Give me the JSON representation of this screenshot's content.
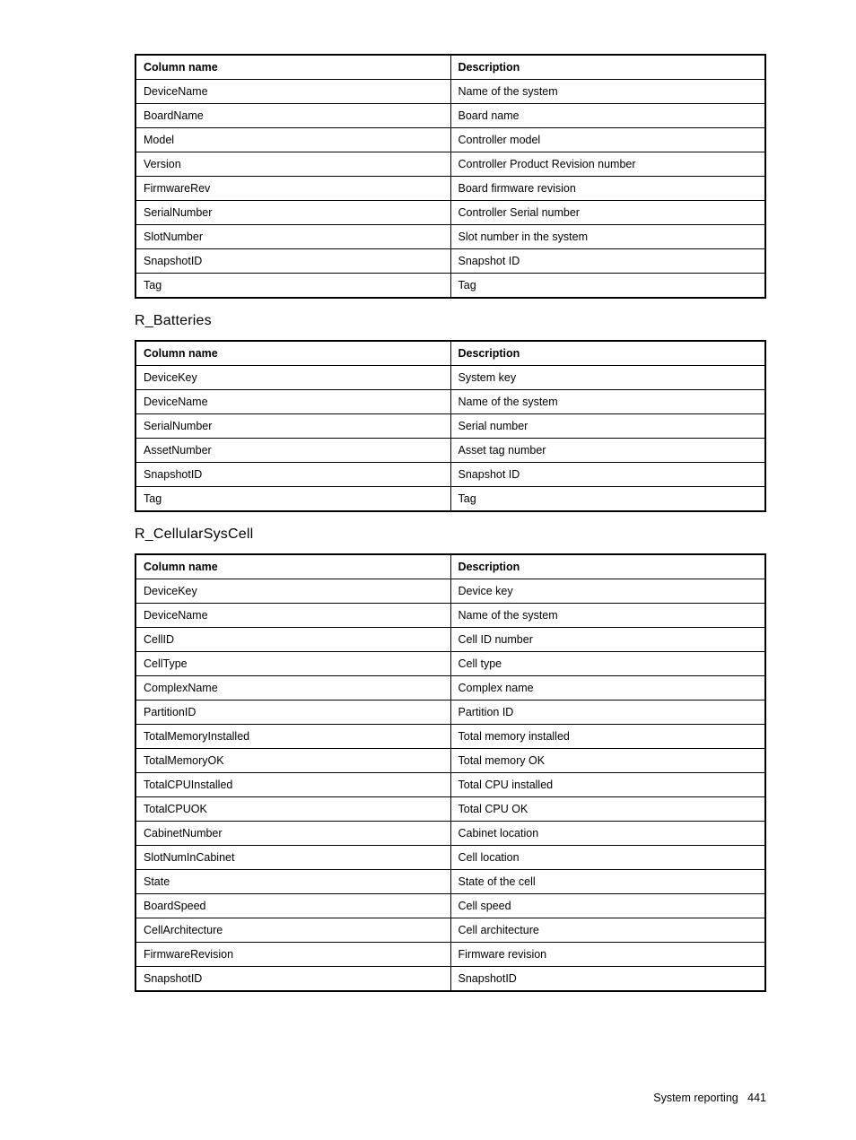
{
  "tables": [
    {
      "title": null,
      "header": {
        "col1": "Column name",
        "col2": "Description"
      },
      "rows": [
        {
          "col1": "DeviceName",
          "col2": "Name of the system"
        },
        {
          "col1": "BoardName",
          "col2": "Board name"
        },
        {
          "col1": "Model",
          "col2": "Controller model"
        },
        {
          "col1": "Version",
          "col2": "Controller Product Revision number"
        },
        {
          "col1": "FirmwareRev",
          "col2": "Board firmware revision"
        },
        {
          "col1": "SerialNumber",
          "col2": "Controller Serial number"
        },
        {
          "col1": "SlotNumber",
          "col2": "Slot number in the system"
        },
        {
          "col1": "SnapshotID",
          "col2": "Snapshot ID"
        },
        {
          "col1": "Tag",
          "col2": "Tag"
        }
      ]
    },
    {
      "title": "R_Batteries",
      "header": {
        "col1": "Column name",
        "col2": "Description"
      },
      "rows": [
        {
          "col1": "DeviceKey",
          "col2": "System key"
        },
        {
          "col1": "DeviceName",
          "col2": "Name of the system"
        },
        {
          "col1": "SerialNumber",
          "col2": "Serial number"
        },
        {
          "col1": "AssetNumber",
          "col2": "Asset tag number"
        },
        {
          "col1": "SnapshotID",
          "col2": "Snapshot ID"
        },
        {
          "col1": "Tag",
          "col2": "Tag"
        }
      ]
    },
    {
      "title": "R_CellularSysCell",
      "header": {
        "col1": "Column name",
        "col2": "Description"
      },
      "rows": [
        {
          "col1": "DeviceKey",
          "col2": "Device key"
        },
        {
          "col1": "DeviceName",
          "col2": "Name of the system"
        },
        {
          "col1": "CellID",
          "col2": "Cell ID number"
        },
        {
          "col1": "CellType",
          "col2": "Cell type"
        },
        {
          "col1": "ComplexName",
          "col2": "Complex name"
        },
        {
          "col1": "PartitionID",
          "col2": "Partition ID"
        },
        {
          "col1": "TotalMemoryInstalled",
          "col2": "Total memory installed"
        },
        {
          "col1": "TotalMemoryOK",
          "col2": "Total memory OK"
        },
        {
          "col1": "TotalCPUInstalled",
          "col2": "Total CPU installed"
        },
        {
          "col1": "TotalCPUOK",
          "col2": "Total CPU OK"
        },
        {
          "col1": "CabinetNumber",
          "col2": "Cabinet location"
        },
        {
          "col1": "SlotNumInCabinet",
          "col2": "Cell location"
        },
        {
          "col1": "State",
          "col2": "State of the cell"
        },
        {
          "col1": "BoardSpeed",
          "col2": "Cell speed"
        },
        {
          "col1": "CellArchitecture",
          "col2": "Cell architecture"
        },
        {
          "col1": "FirmwareRevision",
          "col2": "Firmware revision"
        },
        {
          "col1": "SnapshotID",
          "col2": "SnapshotID"
        }
      ]
    }
  ],
  "footer": {
    "section": "System reporting",
    "page": "441"
  }
}
